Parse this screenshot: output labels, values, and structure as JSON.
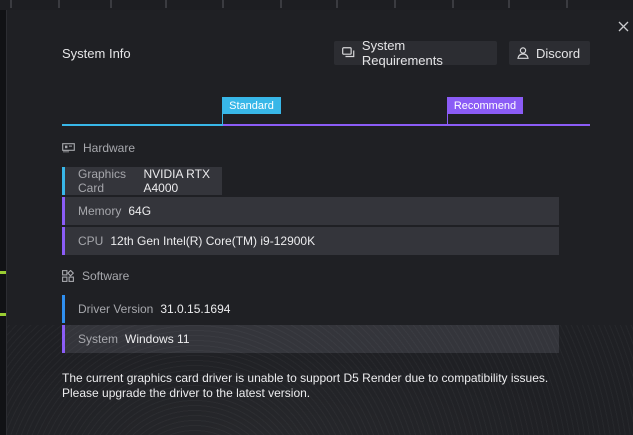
{
  "dialog": {
    "title": "System Info",
    "close_icon": "close-icon"
  },
  "header_buttons": {
    "system_requirements": {
      "label": "System Requirements",
      "icon": "chat-icon"
    },
    "discord": {
      "label": "Discord",
      "icon": "user-icon"
    }
  },
  "levels": {
    "standard": {
      "label": "Standard",
      "color": "#38b7e8"
    },
    "recommend": {
      "label": "Recommend",
      "color": "#8b5cf6"
    }
  },
  "hardware": {
    "heading": "Hardware",
    "icon": "gpu-icon",
    "rows": [
      {
        "key": "Graphics Card",
        "value": "NVIDIA RTX A4000",
        "level": "standard"
      },
      {
        "key": "Memory",
        "value": "64G",
        "level": "recommend"
      },
      {
        "key": "CPU",
        "value": "12th Gen Intel(R) Core(TM) i9-12900K",
        "level": "recommend"
      }
    ]
  },
  "software": {
    "heading": "Software",
    "icon": "apps-icon",
    "rows": [
      {
        "key": "Driver Version",
        "value": "31.0.15.1694",
        "level": "below"
      },
      {
        "key": "System",
        "value": "Windows 11",
        "level": "recommend"
      }
    ]
  },
  "message": {
    "line1": "The current graphics card driver is unable to support D5 Render due to compatibility issues.",
    "line2": "Please upgrade the driver to the latest version."
  },
  "colors": {
    "accent_standard": "#38b7e8",
    "accent_recommend": "#8b5cf6",
    "accent_below": "#2f8ff0"
  }
}
